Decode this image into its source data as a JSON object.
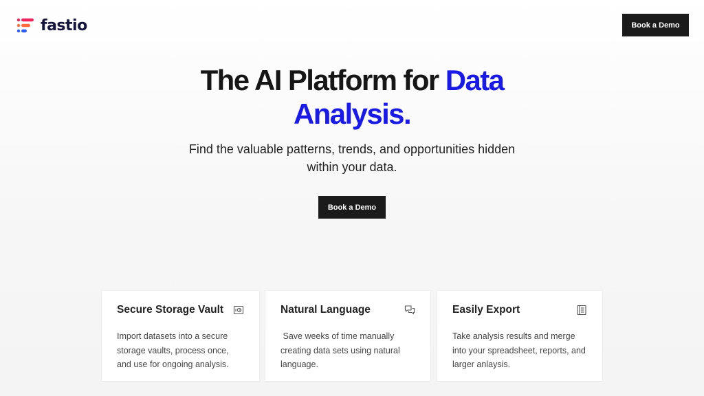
{
  "brand": {
    "name": "fastio",
    "colors": {
      "accent": "#1a1ae6",
      "dark_button": "#1b1b1b",
      "logo_text": "#14143c",
      "logo_red": "#f0245a",
      "logo_orange": "#ff6b3a",
      "logo_blue": "#2b5cff"
    }
  },
  "header": {
    "cta_label": "Book a Demo"
  },
  "hero": {
    "title_main": "The AI Platform for ",
    "title_accent": "Data Analysis.",
    "subtitle": "Find the valuable patterns, trends, and opportunities hidden within your data.",
    "cta_label": "Book a Demo"
  },
  "features": [
    {
      "title": "Secure Storage Vault",
      "icon": "vault-icon",
      "body": "Import datasets into a secure storage vaults, process once, and use for ongoing analysis."
    },
    {
      "title": "Natural Language",
      "icon": "chat-bubbles-icon",
      "body": " Save weeks of time manually creating data sets using natural language."
    },
    {
      "title": "Easily Export",
      "icon": "document-icon",
      "body": "Take analysis results and merge into your spreadsheet, reports, and larger anlaysis."
    }
  ]
}
